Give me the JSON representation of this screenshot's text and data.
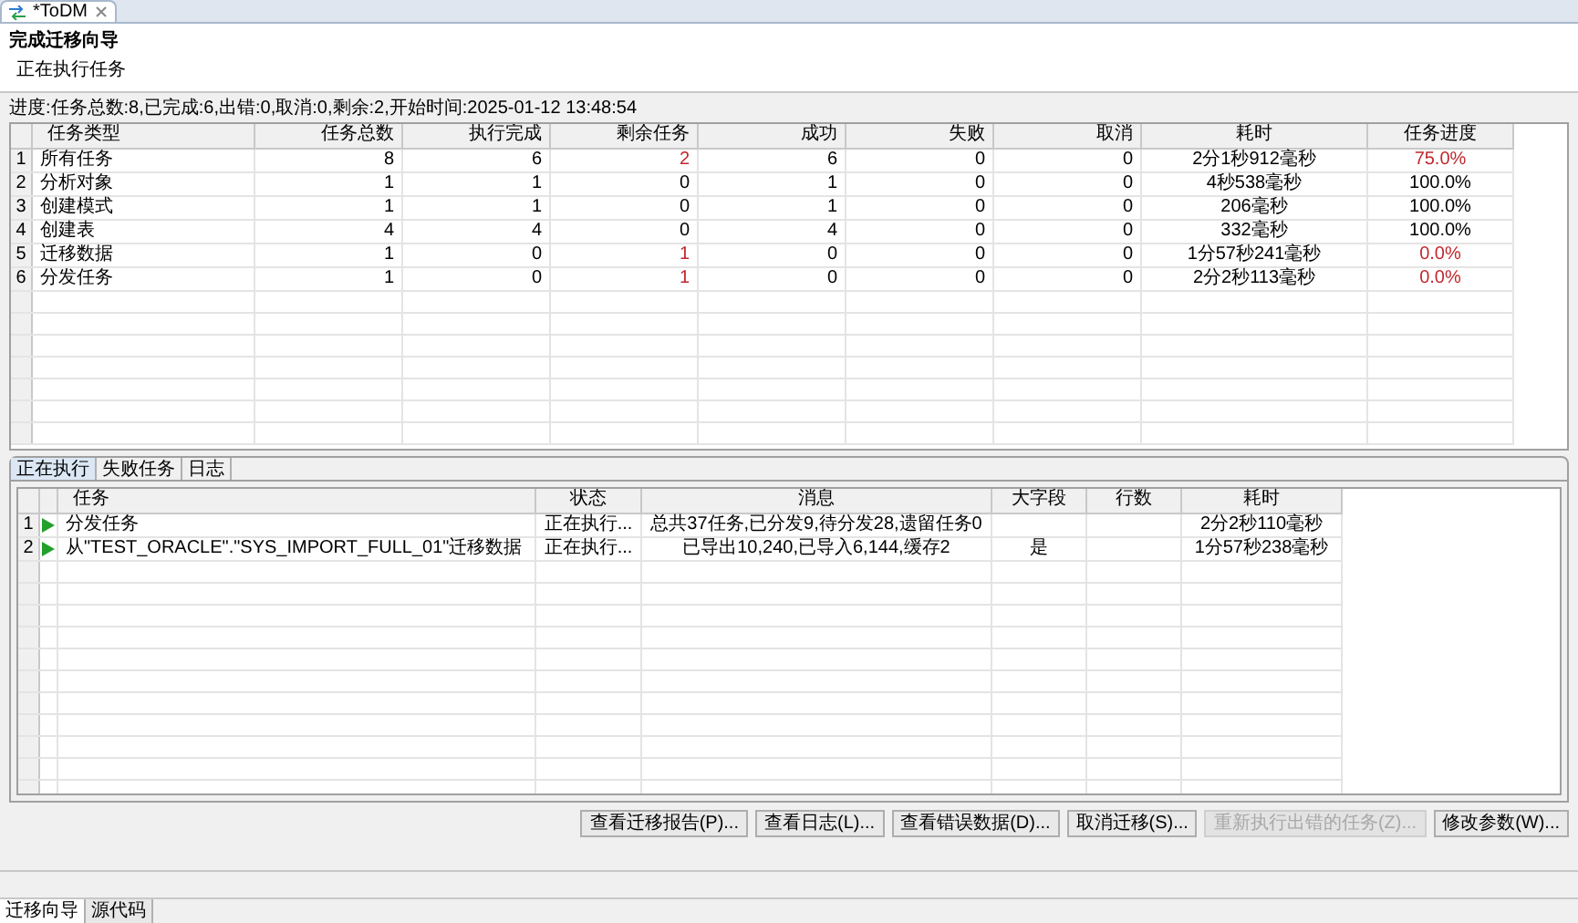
{
  "editor_tab": {
    "title": "*ToDM"
  },
  "wizard": {
    "title": "完成迁移向导",
    "subtitle": "正在执行任务"
  },
  "progress_text": "进度:任务总数:8,已完成:6,出错:0,取消:0,剩余:2,开始时间:2025-01-12 13:48:54",
  "task_table": {
    "columns": [
      {
        "label": "任务类型",
        "kind": "text"
      },
      {
        "label": "任务总数",
        "kind": "number"
      },
      {
        "label": "执行完成",
        "kind": "number"
      },
      {
        "label": "剩余任务",
        "kind": "alert_number"
      },
      {
        "label": "成功",
        "kind": "number"
      },
      {
        "label": "失败",
        "kind": "number"
      },
      {
        "label": "取消",
        "kind": "number"
      },
      {
        "label": "耗时",
        "kind": "center"
      },
      {
        "label": "任务进度",
        "kind": "alert_center"
      }
    ],
    "rows": [
      {
        "number": "1",
        "incomplete": true,
        "cells": [
          "所有任务",
          "8",
          "6",
          "2",
          "6",
          "0",
          "0",
          "2分1秒912毫秒",
          "75.0%"
        ]
      },
      {
        "number": "2",
        "incomplete": false,
        "cells": [
          "分析对象",
          "1",
          "1",
          "0",
          "1",
          "0",
          "0",
          "4秒538毫秒",
          "100.0%"
        ]
      },
      {
        "number": "3",
        "incomplete": false,
        "cells": [
          "创建模式",
          "1",
          "1",
          "0",
          "1",
          "0",
          "0",
          "206毫秒",
          "100.0%"
        ]
      },
      {
        "number": "4",
        "incomplete": false,
        "cells": [
          "创建表",
          "4",
          "4",
          "0",
          "4",
          "0",
          "0",
          "332毫秒",
          "100.0%"
        ]
      },
      {
        "number": "5",
        "incomplete": true,
        "cells": [
          "迁移数据",
          "1",
          "0",
          "1",
          "0",
          "0",
          "0",
          "1分57秒241毫秒",
          "0.0%"
        ]
      },
      {
        "number": "6",
        "incomplete": true,
        "cells": [
          "分发任务",
          "1",
          "0",
          "1",
          "0",
          "0",
          "0",
          "2分2秒113毫秒",
          "0.0%"
        ]
      }
    ]
  },
  "bottom_tabs": [
    {
      "label": "正在执行",
      "selected": true
    },
    {
      "label": "失败任务",
      "selected": false
    },
    {
      "label": "日志",
      "selected": false
    }
  ],
  "running_table": {
    "columns": [
      {
        "label": "任务",
        "kind": "text"
      },
      {
        "label": "状态",
        "kind": "center"
      },
      {
        "label": "消息",
        "kind": "center"
      },
      {
        "label": "大字段",
        "kind": "center"
      },
      {
        "label": "行数",
        "kind": "center"
      },
      {
        "label": "耗时",
        "kind": "center"
      }
    ],
    "rows": [
      {
        "number": "1",
        "running": true,
        "cells": [
          "分发任务",
          "正在执行...",
          "总共37任务,已分发9,待分发28,遗留任务0",
          "",
          "",
          "2分2秒110毫秒"
        ]
      },
      {
        "number": "2",
        "running": true,
        "cells": [
          "从\"TEST_ORACLE\".\"SYS_IMPORT_FULL_01\"迁移数据",
          "正在执行...",
          "已导出10,240,已导入6,144,缓存2",
          "是",
          "",
          "1分57秒238毫秒"
        ]
      }
    ]
  },
  "buttons": [
    {
      "label": "查看迁移报告(P)...",
      "disabled": false
    },
    {
      "label": "查看日志(L)...",
      "disabled": false
    },
    {
      "label": "查看错误数据(D)...",
      "disabled": false
    },
    {
      "label": "取消迁移(S)...",
      "disabled": false
    },
    {
      "label": "重新执行出错的任务(Z)...",
      "disabled": true
    },
    {
      "label": "修改参数(W)...",
      "disabled": false
    }
  ],
  "footer_tabs": [
    {
      "label": "迁移向导",
      "selected": true
    },
    {
      "label": "源代码",
      "selected": false
    }
  ]
}
